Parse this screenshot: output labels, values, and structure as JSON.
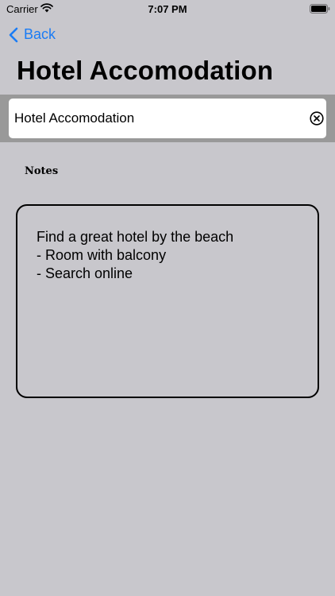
{
  "status_bar": {
    "carrier": "Carrier",
    "time": "7:07 PM",
    "icons": [
      "wifi-icon",
      "battery-icon"
    ]
  },
  "nav": {
    "back_label": "Back",
    "back_icon": "chevron-left-icon",
    "accent_color": "#1a7cf5"
  },
  "page": {
    "title": "Hotel Accomodation"
  },
  "title_field": {
    "value": "Hotel Accomodation",
    "clear_icon": "clear-circle-x-icon"
  },
  "notes": {
    "label": "Notes",
    "lines": [
      "Find a great hotel by the beach",
      "- Room with balcony",
      "- Search online"
    ]
  },
  "colors": {
    "background": "#c8c7cc",
    "field_band": "#999999"
  }
}
